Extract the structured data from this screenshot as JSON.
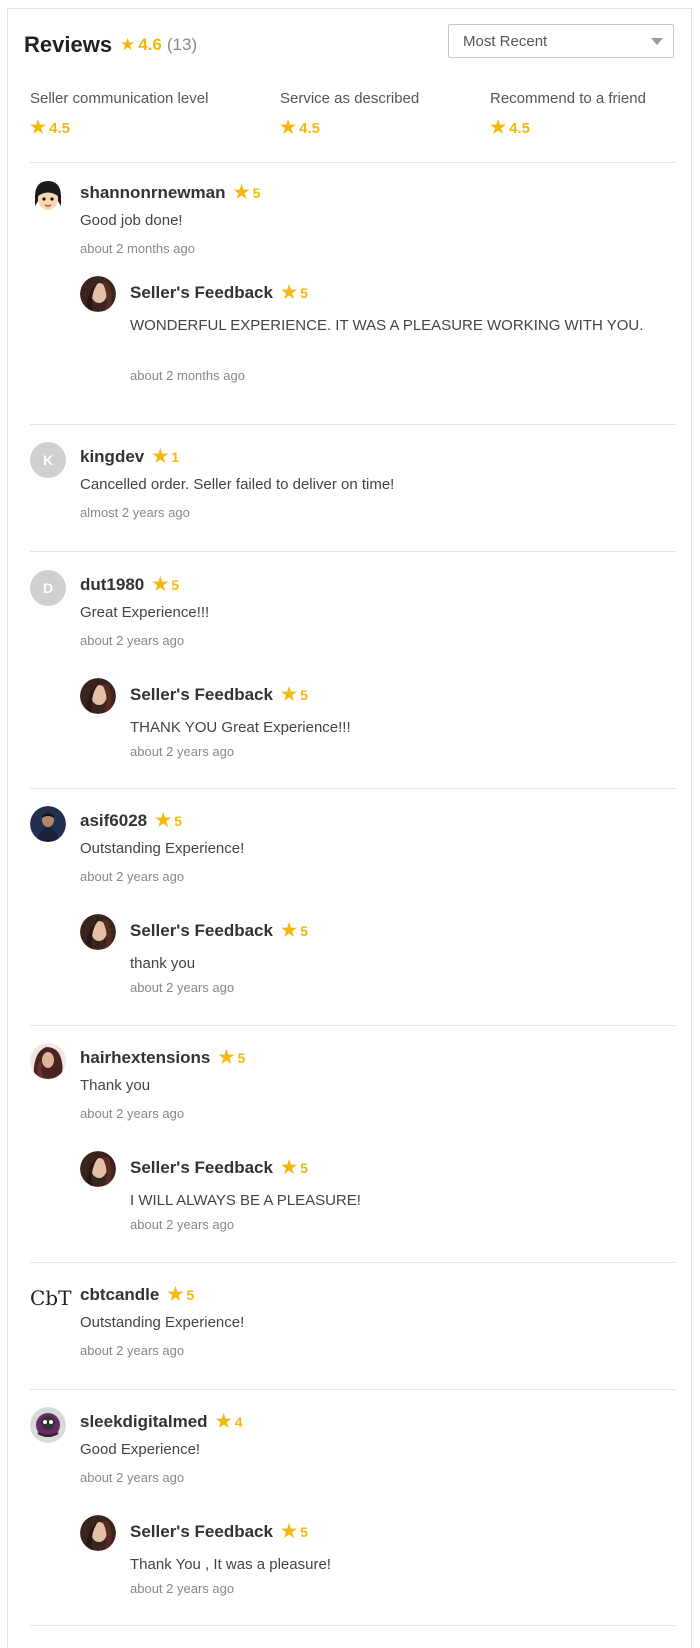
{
  "header": {
    "title": "Reviews",
    "rating": "4.6",
    "count": "(13)",
    "sort": {
      "selected": "Most Recent",
      "icon": "chevron-down-icon"
    }
  },
  "metrics": [
    {
      "label": "Seller communication level",
      "value": "4.5"
    },
    {
      "label": "Service as described",
      "value": "4.5"
    },
    {
      "label": "Recommend to a friend",
      "value": "4.5"
    }
  ],
  "reviews": [
    {
      "user": "shannonrnewman",
      "rating": "5",
      "text": "Good job done!",
      "time": "about 2 months ago",
      "avatar": "cartoon-girl-avatar",
      "feedback": {
        "title": "Seller's Feedback",
        "rating": "5",
        "text": "WONDERFUL EXPERIENCE. IT WAS A PLEASURE WORKING WITH YOU.",
        "time": "about 2 months ago"
      }
    },
    {
      "user": "kingdev",
      "rating": "1",
      "text": "Cancelled order. Seller failed to deliver on time!",
      "time": "almost 2 years ago",
      "avatar_letter": "K"
    },
    {
      "user": "dut1980",
      "rating": "5",
      "text": "Great Experience!!!",
      "time": "about 2 years ago",
      "avatar_letter": "D",
      "feedback": {
        "title": "Seller's Feedback",
        "rating": "5",
        "text": "THANK YOU Great Experience!!!",
        "time": "about 2 years ago"
      }
    },
    {
      "user": "asif6028",
      "rating": "5",
      "text": "Outstanding Experience!",
      "time": "about 2 years ago",
      "avatar": "photo-avatar",
      "feedback": {
        "title": "Seller's Feedback",
        "rating": "5",
        "text": "thank you",
        "time": "about 2 years ago"
      }
    },
    {
      "user": "hairhextensions",
      "rating": "5",
      "text": "Thank you",
      "time": "about 2 years ago",
      "avatar": "photo-avatar",
      "feedback": {
        "title": "Seller's Feedback",
        "rating": "5",
        "text": "I WILL ALWAYS BE A PLEASURE!",
        "time": "about 2 years ago"
      }
    },
    {
      "user": "cbtcandle",
      "rating": "5",
      "text": "Outstanding Experience!",
      "time": "about 2 years ago",
      "avatar": "cbt-logo-avatar"
    },
    {
      "user": "sleekdigitalmed",
      "rating": "4",
      "text": "Good Experience!",
      "time": "about 2 years ago",
      "avatar": "photo-avatar",
      "feedback": {
        "title": "Seller's Feedback",
        "rating": "5",
        "text": "Thank You , It was a pleasure!",
        "time": "about 2 years ago"
      }
    }
  ],
  "colors": {
    "accent": "#f5b80a",
    "divider": "#e4e4e4",
    "text": "#444444",
    "muted": "#888888"
  }
}
